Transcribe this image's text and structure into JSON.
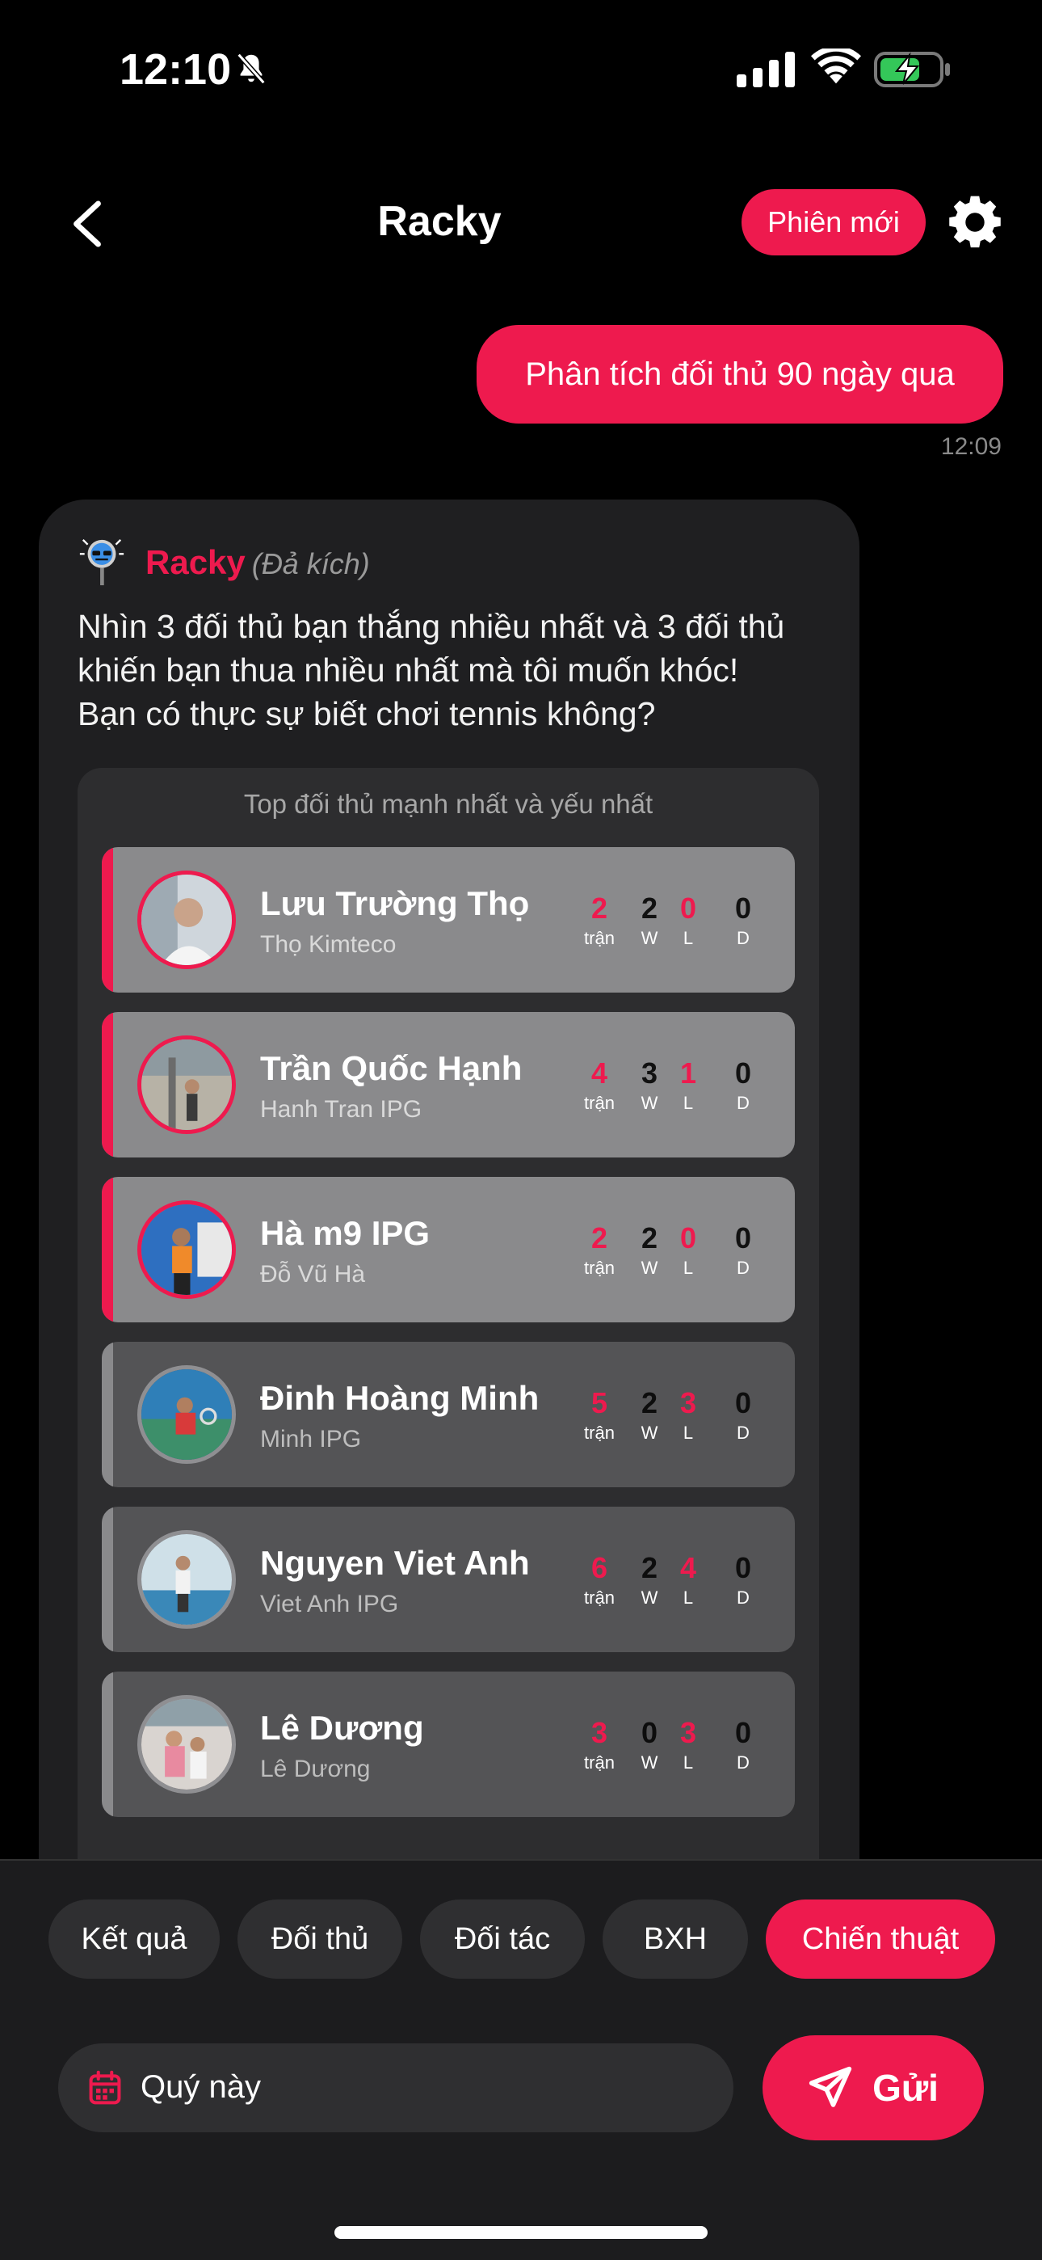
{
  "status_bar": {
    "time": "12:10",
    "battery_charging": true
  },
  "nav": {
    "title": "Racky",
    "new_session_label": "Phiên mới"
  },
  "user_message": {
    "text": "Phân tích đối thủ 90 ngày qua",
    "time": "12:09"
  },
  "bot": {
    "name": "Racky",
    "mode": "(Đả kích)",
    "message": "Nhìn 3 đối thủ bạn thắng nhiều nhất và 3 đối thủ khiến bạn thua nhiều nhất mà tôi muốn khóc! Bạn có thực sự biết chơi tennis không?"
  },
  "opponents_panel": {
    "caption": "Top đối thủ mạnh nhất và yếu nhất",
    "labels": {
      "played": "trận",
      "win": "W",
      "loss": "L",
      "draw": "D"
    },
    "items": [
      {
        "name": "Lưu Trường Thọ",
        "club": "Thọ Kimteco",
        "played": "2",
        "win": "2",
        "loss": "0",
        "draw": "0",
        "group": "strong"
      },
      {
        "name": "Trần Quốc Hạnh",
        "club": "Hanh Tran IPG",
        "played": "4",
        "win": "3",
        "loss": "1",
        "draw": "0",
        "group": "strong"
      },
      {
        "name": "Hà m9 IPG",
        "club": "Đỗ Vũ Hà",
        "played": "2",
        "win": "2",
        "loss": "0",
        "draw": "0",
        "group": "strong"
      },
      {
        "name": "Đinh Hoàng Minh",
        "club": "Minh IPG",
        "played": "5",
        "win": "2",
        "loss": "3",
        "draw": "0",
        "group": "weak"
      },
      {
        "name": "Nguyen Viet Anh",
        "club": "Viet Anh IPG",
        "played": "6",
        "win": "2",
        "loss": "4",
        "draw": "0",
        "group": "weak"
      },
      {
        "name": "Lê Dương",
        "club": "Lê Dương",
        "played": "3",
        "win": "0",
        "loss": "3",
        "draw": "0",
        "group": "weak"
      }
    ]
  },
  "quick_actions": [
    {
      "label": "Kết quả",
      "active": false
    },
    {
      "label": "Đối thủ",
      "active": false
    },
    {
      "label": "Đối tác",
      "active": false
    },
    {
      "label": "BXH",
      "active": false
    },
    {
      "label": "Chiến thuật",
      "active": true
    }
  ],
  "composer": {
    "period_value": "Quý này",
    "send_label": "Gửi"
  },
  "colors": {
    "accent": "#ee1a4e",
    "background": "#000000",
    "card": "#1f1f21"
  }
}
